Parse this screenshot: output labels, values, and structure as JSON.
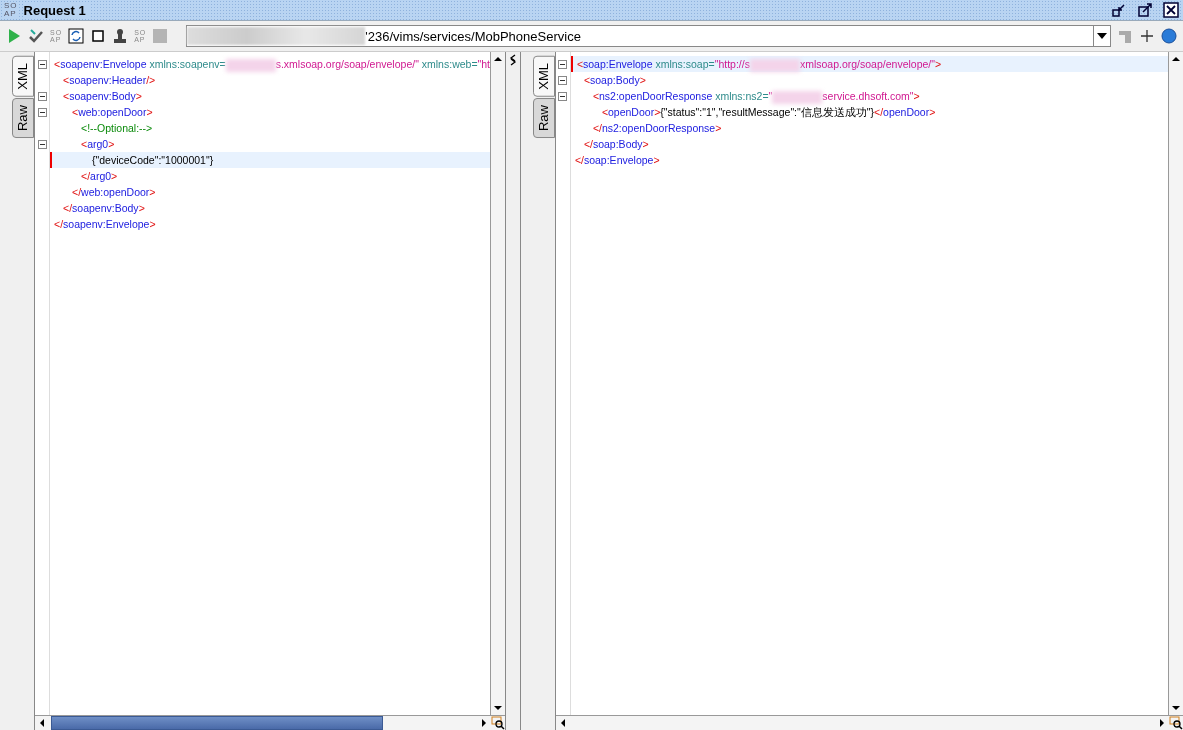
{
  "window": {
    "logo": [
      "SO",
      "AP"
    ],
    "title": "Request 1"
  },
  "toolbar": {
    "tools": [
      {
        "kind": "play"
      },
      {
        "kind": "check"
      },
      {
        "kind": "letters",
        "label": [
          "SO",
          "AP"
        ]
      },
      {
        "kind": "refresh"
      },
      {
        "kind": "square"
      },
      {
        "kind": "stamp"
      },
      {
        "kind": "letters",
        "label": [
          "SO",
          "AP"
        ]
      },
      {
        "kind": "stop"
      }
    ],
    "endpoint": "'236/vims/services/MobPhoneService"
  },
  "panes": [
    {
      "tabs": [
        {
          "label": "XML",
          "selected": true
        },
        {
          "label": "Raw",
          "selected": false
        }
      ],
      "lines": [
        {
          "current": false,
          "expanded": true,
          "tokens": [
            {
              "kind": "punct",
              "text": "<"
            },
            {
              "kind": "name",
              "text": "soapenv:Envelope"
            },
            {
              "kind": "attr",
              "text": " xmlns:soapenv="
            },
            {
              "kind": "redaction"
            },
            {
              "kind": "value",
              "text": "s.xmlsoap.org/soap/envelope/\""
            },
            {
              "kind": "attr",
              "text": " xmlns:web="
            },
            {
              "kind": "value",
              "text": "\"ht"
            }
          ],
          "children": [
            {
              "current": false,
              "tokens": [
                {
                  "kind": "punct",
                  "text": "<"
                },
                {
                  "kind": "name",
                  "text": "soapenv:Header"
                },
                {
                  "kind": "punct",
                  "text": "/>"
                }
              ]
            },
            {
              "current": false,
              "expanded": true,
              "tokens": [
                {
                  "kind": "punct",
                  "text": "<"
                },
                {
                  "kind": "name",
                  "text": "soapenv:Body"
                },
                {
                  "kind": "punct",
                  "text": ">"
                }
              ],
              "children": [
                {
                  "current": false,
                  "expanded": true,
                  "tokens": [
                    {
                      "kind": "punct",
                      "text": "<"
                    },
                    {
                      "kind": "name",
                      "text": "web:openDoor"
                    },
                    {
                      "kind": "punct",
                      "text": ">"
                    }
                  ],
                  "children": [
                    {
                      "current": false,
                      "tokens": [
                        {
                          "kind": "comment",
                          "text": "<!--Optional:-->"
                        }
                      ]
                    },
                    {
                      "current": false,
                      "expanded": true,
                      "tokens": [
                        {
                          "kind": "punct",
                          "text": "<"
                        },
                        {
                          "kind": "name",
                          "text": "arg0"
                        },
                        {
                          "kind": "punct",
                          "text": ">"
                        }
                      ],
                      "children": [
                        {
                          "current": true,
                          "tokens": [
                            {
                              "kind": "text",
                              "text": "{\"deviceCode\":\"1000001\"}"
                            }
                          ]
                        }
                      ],
                      "close": [
                        {
                          "kind": "punct",
                          "text": "</"
                        },
                        {
                          "kind": "name",
                          "text": "arg0"
                        },
                        {
                          "kind": "punct",
                          "text": ">"
                        }
                      ]
                    }
                  ],
                  "close": [
                    {
                      "kind": "punct",
                      "text": "</"
                    },
                    {
                      "kind": "name",
                      "text": "web:openDoor"
                    },
                    {
                      "kind": "punct",
                      "text": ">"
                    }
                  ]
                }
              ],
              "close": [
                {
                  "kind": "punct",
                  "text": "</"
                },
                {
                  "kind": "name",
                  "text": "soapenv:Body"
                },
                {
                  "kind": "punct",
                  "text": ">"
                }
              ]
            }
          ],
          "close": [
            {
              "kind": "punct",
              "text": "</"
            },
            {
              "kind": "name",
              "text": "soapenv:Envelope"
            },
            {
              "kind": "punct",
              "text": ">"
            }
          ]
        }
      ]
    },
    {
      "tabs": [
        {
          "label": "XML",
          "selected": true
        },
        {
          "label": "Raw",
          "selected": false
        }
      ],
      "lines": [
        {
          "current": true,
          "expanded": true,
          "tokens": [
            {
              "kind": "punct",
              "text": "<"
            },
            {
              "kind": "name",
              "text": "soap:Envelope"
            },
            {
              "kind": "attr",
              "text": " xmlns:soap="
            },
            {
              "kind": "value",
              "text": "\"http://s"
            },
            {
              "kind": "redaction"
            },
            {
              "kind": "value",
              "text": "xmlsoap.org/soap/envelope/\""
            },
            {
              "kind": "punct",
              "text": ">"
            }
          ],
          "children": [
            {
              "current": false,
              "expanded": true,
              "tokens": [
                {
                  "kind": "punct",
                  "text": "<"
                },
                {
                  "kind": "name",
                  "text": "soap:Body"
                },
                {
                  "kind": "punct",
                  "text": ">"
                }
              ],
              "children": [
                {
                  "current": false,
                  "expanded": true,
                  "tokens": [
                    {
                      "kind": "punct",
                      "text": "<"
                    },
                    {
                      "kind": "name",
                      "text": "ns2:openDoorResponse"
                    },
                    {
                      "kind": "attr",
                      "text": " xmlns:ns2="
                    },
                    {
                      "kind": "value",
                      "text": "\""
                    },
                    {
                      "kind": "redaction"
                    },
                    {
                      "kind": "value",
                      "text": "service.dhsoft.com\""
                    },
                    {
                      "kind": "punct",
                      "text": ">"
                    }
                  ],
                  "children": [
                    {
                      "current": false,
                      "tokens": [
                        {
                          "kind": "punct",
                          "text": "<"
                        },
                        {
                          "kind": "name",
                          "text": "openDoor"
                        },
                        {
                          "kind": "punct",
                          "text": ">"
                        },
                        {
                          "kind": "text",
                          "text": "{\"status\":\"1\",\"resultMessage\":\"信息发送成功\"}"
                        },
                        {
                          "kind": "punct",
                          "text": "</"
                        },
                        {
                          "kind": "name",
                          "text": "openDoor"
                        },
                        {
                          "kind": "punct",
                          "text": ">"
                        }
                      ]
                    }
                  ],
                  "close": [
                    {
                      "kind": "punct",
                      "text": "</"
                    },
                    {
                      "kind": "name",
                      "text": "ns2:openDoorResponse"
                    },
                    {
                      "kind": "punct",
                      "text": ">"
                    }
                  ]
                }
              ],
              "close": [
                {
                  "kind": "punct",
                  "text": "</"
                },
                {
                  "kind": "name",
                  "text": "soap:Body"
                },
                {
                  "kind": "punct",
                  "text": ">"
                }
              ]
            }
          ],
          "close": [
            {
              "kind": "punct",
              "text": "</"
            },
            {
              "kind": "name",
              "text": "soap:Envelope"
            },
            {
              "kind": "punct",
              "text": ">"
            }
          ]
        }
      ]
    }
  ]
}
